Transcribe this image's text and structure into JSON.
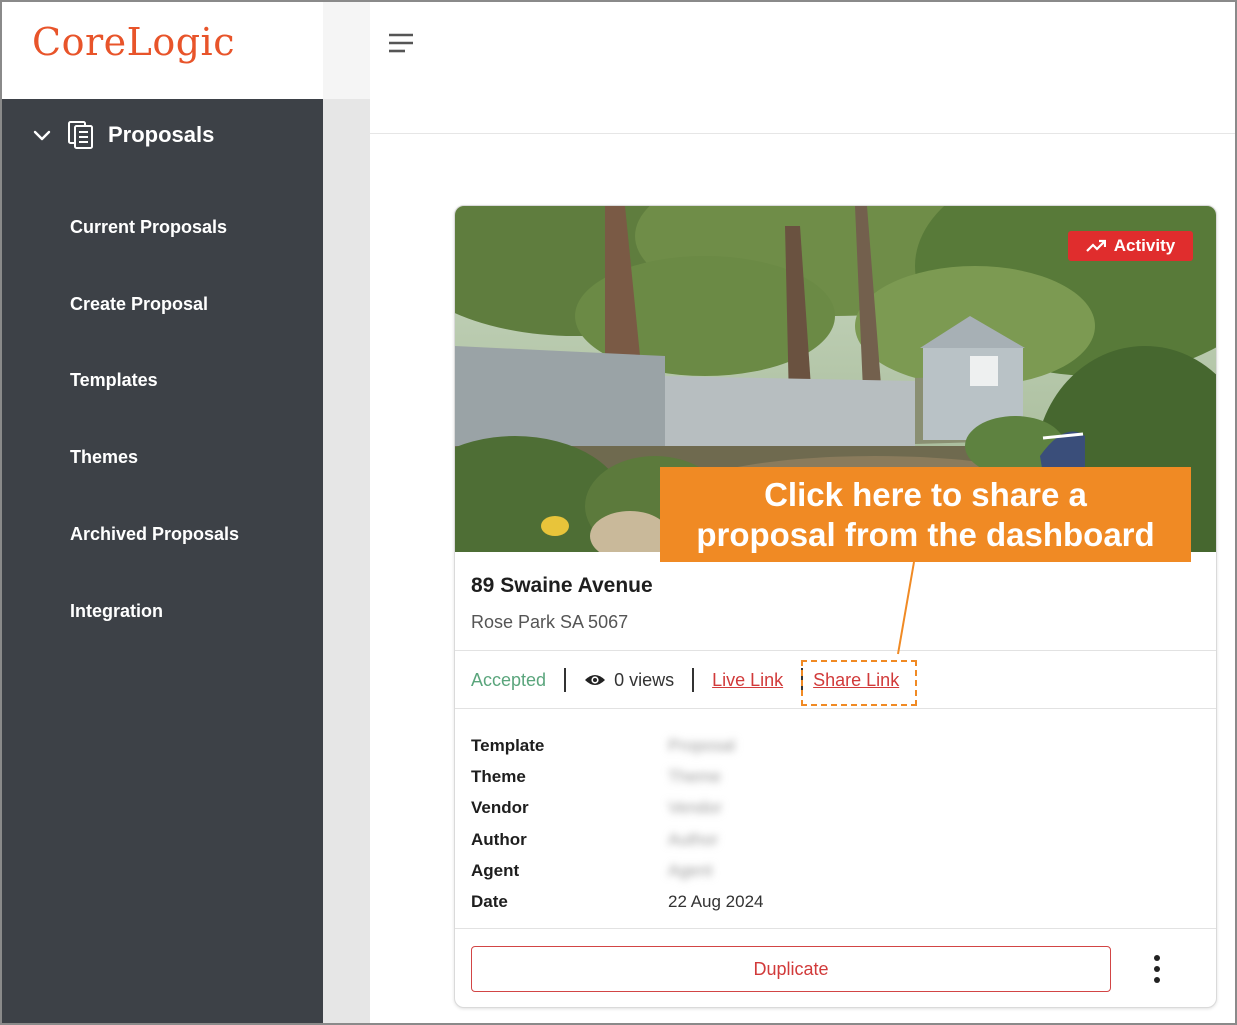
{
  "brand": {
    "logo_text": "CoreLogic",
    "color": "#e8542a"
  },
  "sidebar": {
    "section_title": "Proposals",
    "items": [
      {
        "label": "Current Proposals"
      },
      {
        "label": "Create Proposal"
      },
      {
        "label": "Templates"
      },
      {
        "label": "Themes"
      },
      {
        "label": "Archived Proposals"
      },
      {
        "label": "Integration"
      }
    ]
  },
  "card": {
    "badge_label": "Activity",
    "address_line1": "89 Swaine Avenue",
    "address_line2": "Rose Park SA 5067",
    "status": "Accepted",
    "views": "0 views",
    "live_link": "Live Link",
    "share_link": "Share Link",
    "details": [
      {
        "label": "Template",
        "value": "Proposal",
        "redacted": true
      },
      {
        "label": "Theme",
        "value": "Theme",
        "redacted": true
      },
      {
        "label": "Vendor",
        "value": "Vendor",
        "redacted": true
      },
      {
        "label": "Author",
        "value": "Author",
        "redacted": true
      },
      {
        "label": "Agent",
        "value": "Agent",
        "redacted": true
      },
      {
        "label": "Date",
        "value": "22 Aug 2024",
        "redacted": false
      }
    ],
    "duplicate_label": "Duplicate"
  },
  "callout": {
    "line1": "Click here to share a",
    "line2": "proposal from the dashboard"
  },
  "colors": {
    "sidebar_bg": "#3d4147",
    "accent_red": "#d13a3a",
    "badge_red": "#e02d2d",
    "callout_orange": "#f08a24",
    "accepted_green": "#5aa57c"
  }
}
